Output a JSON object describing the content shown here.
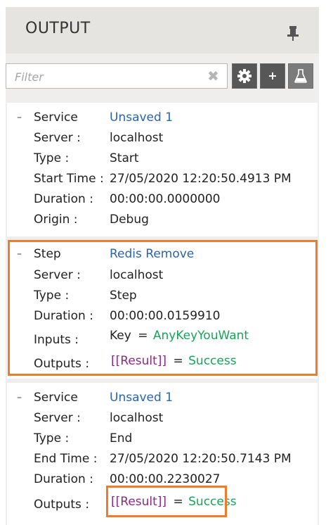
{
  "header": {
    "title": "OUTPUT",
    "pin_icon": "pin-icon"
  },
  "toolbar": {
    "filter_placeholder": "Filter",
    "clear_icon": "close-icon",
    "settings_icon": "gear-icon",
    "add_label": "+",
    "debug_icon": "flask-icon"
  },
  "blocks": [
    {
      "title_key": "Service",
      "title_value": "Unsaved 1",
      "rows": [
        {
          "key": "Server :",
          "value": "localhost"
        },
        {
          "key": "Type :",
          "value": "Start"
        },
        {
          "key": "Start Time :",
          "value": "27/05/2020 12:20:50.4913 PM"
        },
        {
          "key": "Duration :",
          "value": "00:00:00.0000000"
        },
        {
          "key": "Origin :",
          "value": "Debug"
        }
      ]
    },
    {
      "title_key": "Step",
      "title_value": "Redis Remove",
      "rows": [
        {
          "key": "Server :",
          "value": "localhost"
        },
        {
          "key": "Type :",
          "value": "Step"
        },
        {
          "key": "Duration :",
          "value": "00:00:00.0159910"
        }
      ],
      "inputs": {
        "key": "Inputs :",
        "name": "Key",
        "eq": "=",
        "value": "AnyKeyYouWant"
      },
      "outputs": {
        "key": "Outputs :",
        "name": "[[Result]]",
        "eq": "=",
        "value": "Success"
      }
    },
    {
      "title_key": "Service",
      "title_value": "Unsaved 1",
      "rows": [
        {
          "key": "Server :",
          "value": "localhost"
        },
        {
          "key": "Type :",
          "value": "End"
        },
        {
          "key": "End Time :",
          "value": "27/05/2020 12:20:50.7143 PM"
        },
        {
          "key": "Duration :",
          "value": "00:00:00.2230027"
        }
      ],
      "outputs": {
        "key": "Outputs :",
        "name": "[[Result]]",
        "eq": "=",
        "value": "Success"
      }
    }
  ],
  "colors": {
    "highlight": "#ef7c2e",
    "link": "#2a64ad",
    "variable": "#8a2a8a",
    "success": "#18a35a"
  }
}
